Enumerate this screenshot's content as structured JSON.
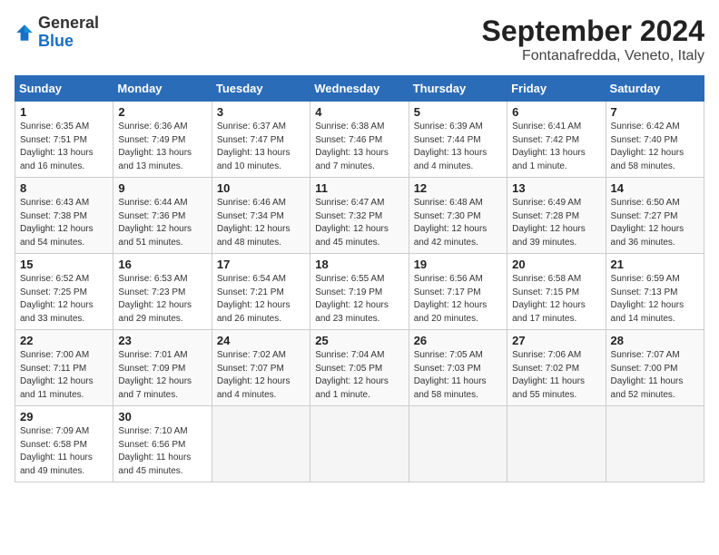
{
  "logo": {
    "general": "General",
    "blue": "Blue"
  },
  "title": "September 2024",
  "location": "Fontanafredda, Veneto, Italy",
  "weekdays": [
    "Sunday",
    "Monday",
    "Tuesday",
    "Wednesday",
    "Thursday",
    "Friday",
    "Saturday"
  ],
  "weeks": [
    [
      {
        "day": "1",
        "info": "Sunrise: 6:35 AM\nSunset: 7:51 PM\nDaylight: 13 hours\nand 16 minutes."
      },
      {
        "day": "2",
        "info": "Sunrise: 6:36 AM\nSunset: 7:49 PM\nDaylight: 13 hours\nand 13 minutes."
      },
      {
        "day": "3",
        "info": "Sunrise: 6:37 AM\nSunset: 7:47 PM\nDaylight: 13 hours\nand 10 minutes."
      },
      {
        "day": "4",
        "info": "Sunrise: 6:38 AM\nSunset: 7:46 PM\nDaylight: 13 hours\nand 7 minutes."
      },
      {
        "day": "5",
        "info": "Sunrise: 6:39 AM\nSunset: 7:44 PM\nDaylight: 13 hours\nand 4 minutes."
      },
      {
        "day": "6",
        "info": "Sunrise: 6:41 AM\nSunset: 7:42 PM\nDaylight: 13 hours\nand 1 minute."
      },
      {
        "day": "7",
        "info": "Sunrise: 6:42 AM\nSunset: 7:40 PM\nDaylight: 12 hours\nand 58 minutes."
      }
    ],
    [
      {
        "day": "8",
        "info": "Sunrise: 6:43 AM\nSunset: 7:38 PM\nDaylight: 12 hours\nand 54 minutes."
      },
      {
        "day": "9",
        "info": "Sunrise: 6:44 AM\nSunset: 7:36 PM\nDaylight: 12 hours\nand 51 minutes."
      },
      {
        "day": "10",
        "info": "Sunrise: 6:46 AM\nSunset: 7:34 PM\nDaylight: 12 hours\nand 48 minutes."
      },
      {
        "day": "11",
        "info": "Sunrise: 6:47 AM\nSunset: 7:32 PM\nDaylight: 12 hours\nand 45 minutes."
      },
      {
        "day": "12",
        "info": "Sunrise: 6:48 AM\nSunset: 7:30 PM\nDaylight: 12 hours\nand 42 minutes."
      },
      {
        "day": "13",
        "info": "Sunrise: 6:49 AM\nSunset: 7:28 PM\nDaylight: 12 hours\nand 39 minutes."
      },
      {
        "day": "14",
        "info": "Sunrise: 6:50 AM\nSunset: 7:27 PM\nDaylight: 12 hours\nand 36 minutes."
      }
    ],
    [
      {
        "day": "15",
        "info": "Sunrise: 6:52 AM\nSunset: 7:25 PM\nDaylight: 12 hours\nand 33 minutes."
      },
      {
        "day": "16",
        "info": "Sunrise: 6:53 AM\nSunset: 7:23 PM\nDaylight: 12 hours\nand 29 minutes."
      },
      {
        "day": "17",
        "info": "Sunrise: 6:54 AM\nSunset: 7:21 PM\nDaylight: 12 hours\nand 26 minutes."
      },
      {
        "day": "18",
        "info": "Sunrise: 6:55 AM\nSunset: 7:19 PM\nDaylight: 12 hours\nand 23 minutes."
      },
      {
        "day": "19",
        "info": "Sunrise: 6:56 AM\nSunset: 7:17 PM\nDaylight: 12 hours\nand 20 minutes."
      },
      {
        "day": "20",
        "info": "Sunrise: 6:58 AM\nSunset: 7:15 PM\nDaylight: 12 hours\nand 17 minutes."
      },
      {
        "day": "21",
        "info": "Sunrise: 6:59 AM\nSunset: 7:13 PM\nDaylight: 12 hours\nand 14 minutes."
      }
    ],
    [
      {
        "day": "22",
        "info": "Sunrise: 7:00 AM\nSunset: 7:11 PM\nDaylight: 12 hours\nand 11 minutes."
      },
      {
        "day": "23",
        "info": "Sunrise: 7:01 AM\nSunset: 7:09 PM\nDaylight: 12 hours\nand 7 minutes."
      },
      {
        "day": "24",
        "info": "Sunrise: 7:02 AM\nSunset: 7:07 PM\nDaylight: 12 hours\nand 4 minutes."
      },
      {
        "day": "25",
        "info": "Sunrise: 7:04 AM\nSunset: 7:05 PM\nDaylight: 12 hours\nand 1 minute."
      },
      {
        "day": "26",
        "info": "Sunrise: 7:05 AM\nSunset: 7:03 PM\nDaylight: 11 hours\nand 58 minutes."
      },
      {
        "day": "27",
        "info": "Sunrise: 7:06 AM\nSunset: 7:02 PM\nDaylight: 11 hours\nand 55 minutes."
      },
      {
        "day": "28",
        "info": "Sunrise: 7:07 AM\nSunset: 7:00 PM\nDaylight: 11 hours\nand 52 minutes."
      }
    ],
    [
      {
        "day": "29",
        "info": "Sunrise: 7:09 AM\nSunset: 6:58 PM\nDaylight: 11 hours\nand 49 minutes."
      },
      {
        "day": "30",
        "info": "Sunrise: 7:10 AM\nSunset: 6:56 PM\nDaylight: 11 hours\nand 45 minutes."
      },
      {
        "day": "",
        "info": ""
      },
      {
        "day": "",
        "info": ""
      },
      {
        "day": "",
        "info": ""
      },
      {
        "day": "",
        "info": ""
      },
      {
        "day": "",
        "info": ""
      }
    ]
  ]
}
